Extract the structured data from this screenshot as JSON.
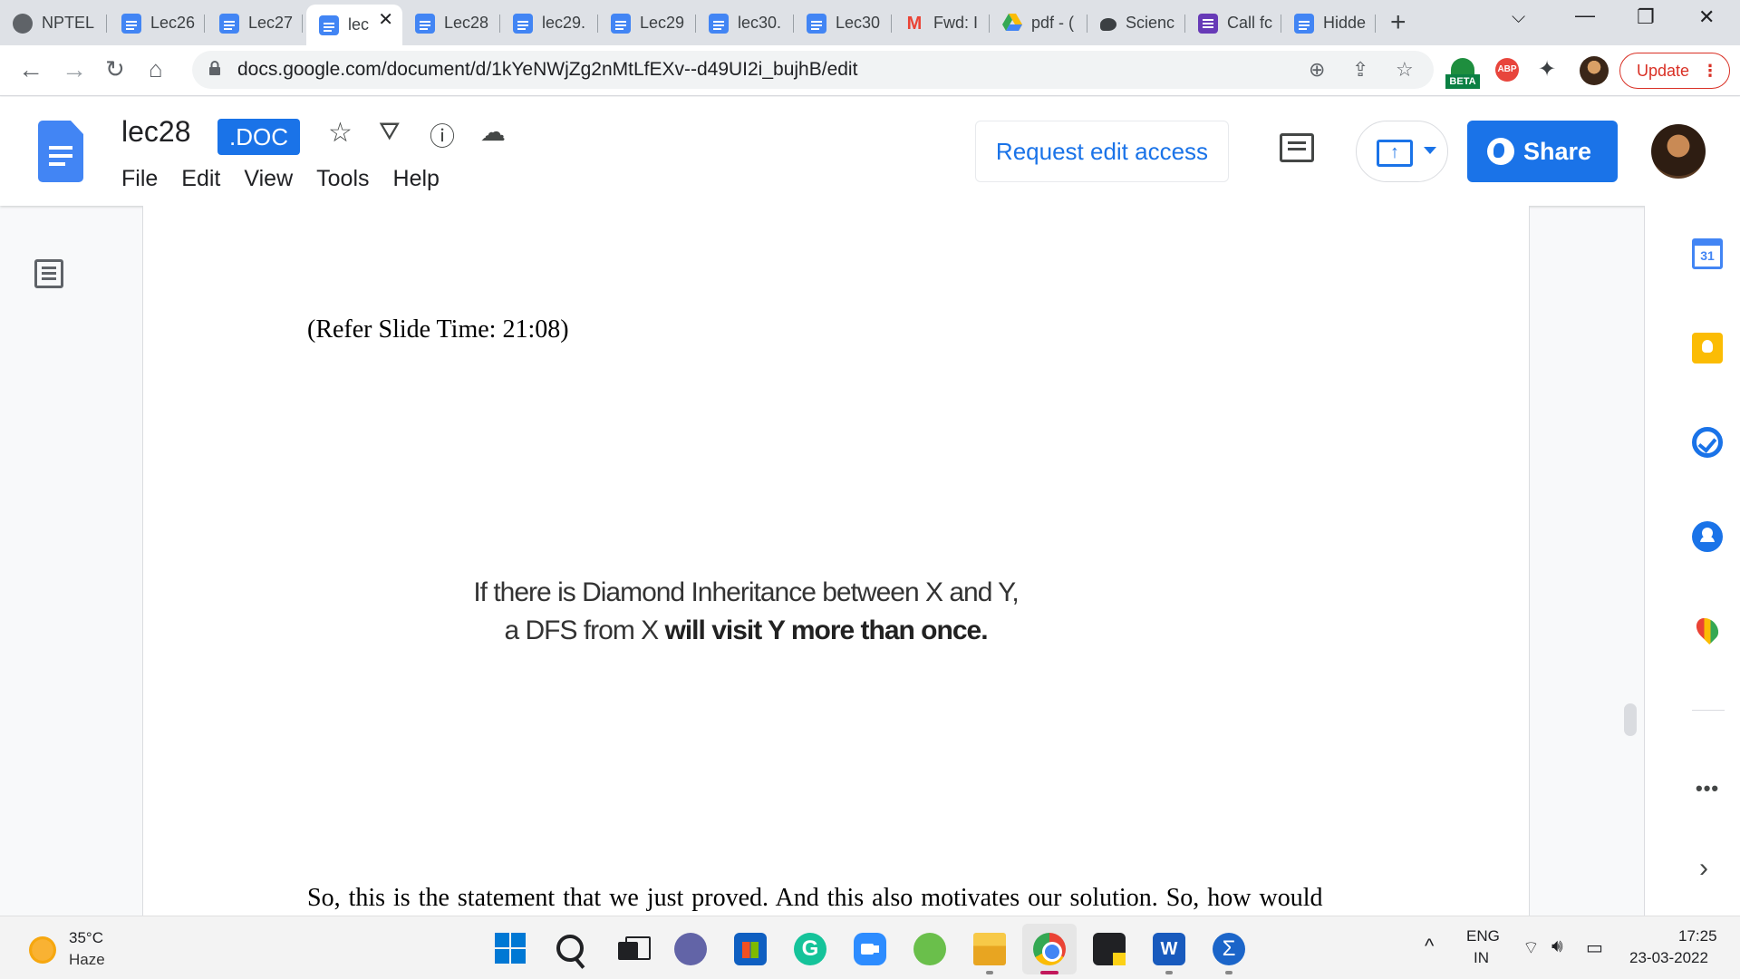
{
  "browser": {
    "tabs": [
      {
        "label": "NPTEL",
        "icon": "globe-icon"
      },
      {
        "label": "Lec26",
        "icon": "docs-icon"
      },
      {
        "label": "Lec27",
        "icon": "docs-icon"
      },
      {
        "label": "lec",
        "icon": "docs-icon",
        "active": true
      },
      {
        "label": "Lec28",
        "icon": "docs-icon"
      },
      {
        "label": "lec29.",
        "icon": "docs-icon"
      },
      {
        "label": "Lec29",
        "icon": "docs-icon"
      },
      {
        "label": "lec30.",
        "icon": "docs-icon"
      },
      {
        "label": "Lec30",
        "icon": "docs-icon"
      },
      {
        "label": "Fwd: I",
        "icon": "gmail-icon"
      },
      {
        "label": "pdf - (",
        "icon": "drive-icon"
      },
      {
        "label": "Scienc",
        "icon": "chat-icon"
      },
      {
        "label": "Call fc",
        "icon": "forms-icon"
      },
      {
        "label": "Hidde",
        "icon": "docs-icon"
      }
    ],
    "url": "docs.google.com/document/d/1kYeNWjZg2nMtLfEXv--d49UI2i_bujhB/edit",
    "beta_label": "BETA",
    "abp_label": "ABP",
    "update_label": "Update"
  },
  "docs": {
    "title": "lec28",
    "badge": ".DOC",
    "menu": [
      "File",
      "Edit",
      "View",
      "Tools",
      "Help"
    ],
    "request_edit": "Request edit access",
    "share_label": "Share",
    "colors": {
      "accent": "#1a73e8",
      "docs_blue": "#4285f4"
    }
  },
  "document": {
    "slide_ref": "(Refer Slide Time: 21:08)",
    "slide_line1": "If there is Diamond Inheritance between X and Y,",
    "slide_line2_pre": "a DFS from X ",
    "slide_line2_bold": "will visit Y more than once.",
    "body_line": "So, this is the statement that we just proved. And this also motivates our solution. So, how would"
  },
  "side_panel": {
    "calendar_day": "31",
    "more_label": "•••",
    "expand_label": "›"
  },
  "taskbar": {
    "temperature": "35°C",
    "weather": "Haze",
    "lang_line1": "ENG",
    "lang_line2": "IN",
    "time": "17:25",
    "date": "23-03-2022"
  }
}
